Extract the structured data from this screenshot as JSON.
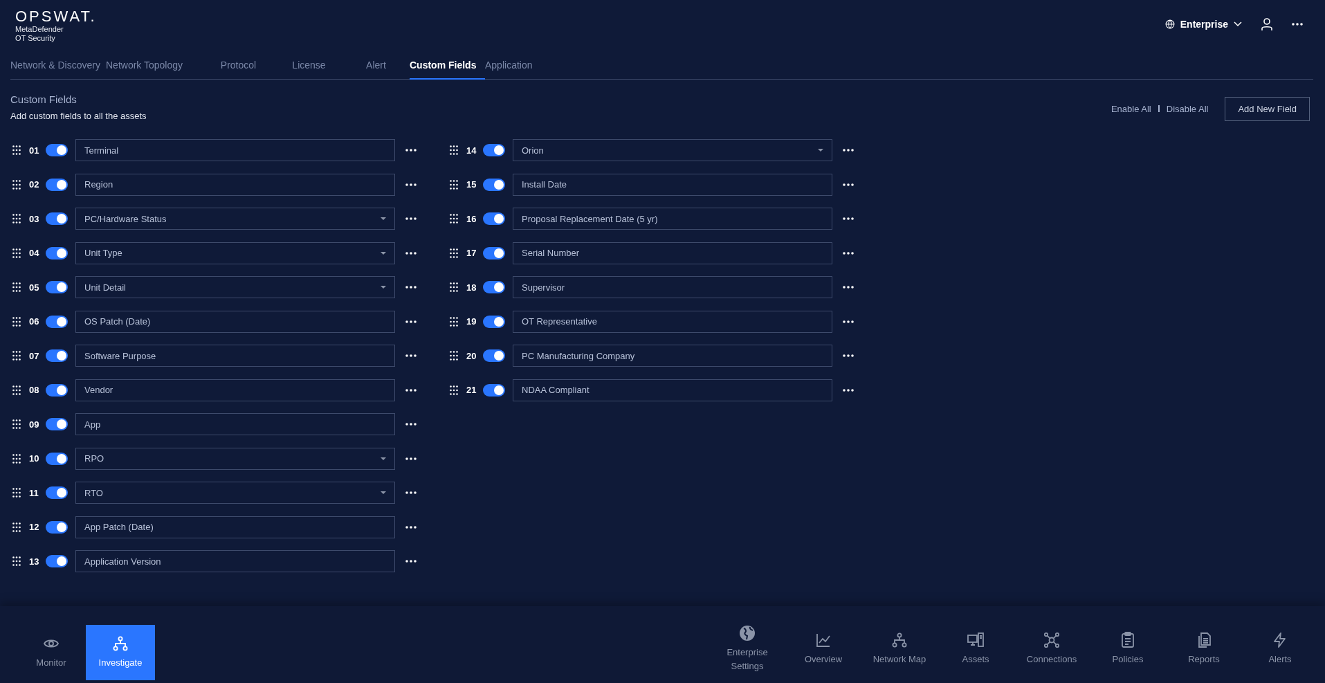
{
  "header": {
    "logo": "OPSWAT.",
    "product": [
      "MetaDefender",
      "OT Security"
    ],
    "workspace": "Enterprise"
  },
  "tabs": [
    {
      "label": "Network & Discovery",
      "selected": false
    },
    {
      "label": "Network Topology",
      "selected": false
    },
    {
      "label": "Protocol",
      "selected": false
    },
    {
      "label": "License",
      "selected": false
    },
    {
      "label": "Alert",
      "selected": false
    },
    {
      "label": "Custom Fields",
      "selected": true
    },
    {
      "label": "Application",
      "selected": false
    }
  ],
  "section": {
    "title": "Custom Fields",
    "subtitle": "Add custom fields to all the assets",
    "enable_all": "Enable All",
    "disable_all": "Disable All",
    "add_button": "Add New Field"
  },
  "field_columns": [
    [
      {
        "number": "01",
        "on": true,
        "kind": "text",
        "value": "Terminal"
      },
      {
        "number": "02",
        "on": true,
        "kind": "text",
        "value": "Region"
      },
      {
        "number": "03",
        "on": true,
        "kind": "dropdown",
        "value": "PC/Hardware Status"
      },
      {
        "number": "04",
        "on": true,
        "kind": "dropdown",
        "value": "Unit Type"
      },
      {
        "number": "05",
        "on": true,
        "kind": "dropdown",
        "value": "Unit Detail"
      },
      {
        "number": "06",
        "on": true,
        "kind": "text",
        "value": "OS Patch (Date)"
      },
      {
        "number": "07",
        "on": true,
        "kind": "text",
        "value": "Software Purpose"
      },
      {
        "number": "08",
        "on": true,
        "kind": "text",
        "value": "Vendor"
      },
      {
        "number": "09",
        "on": true,
        "kind": "text",
        "value": "App"
      },
      {
        "number": "10",
        "on": true,
        "kind": "dropdown",
        "value": "RPO"
      },
      {
        "number": "11",
        "on": true,
        "kind": "dropdown",
        "value": "RTO"
      },
      {
        "number": "12",
        "on": true,
        "kind": "text",
        "value": "App Patch (Date)"
      },
      {
        "number": "13",
        "on": true,
        "kind": "text",
        "value": "Application Version"
      }
    ],
    [
      {
        "number": "14",
        "on": true,
        "kind": "dropdown",
        "value": "Orion"
      },
      {
        "number": "15",
        "on": true,
        "kind": "text",
        "value": "Install Date"
      },
      {
        "number": "16",
        "on": true,
        "kind": "text",
        "value": "Proposal Replacement Date (5 yr)"
      },
      {
        "number": "17",
        "on": true,
        "kind": "text",
        "value": "Serial Number"
      },
      {
        "number": "18",
        "on": true,
        "kind": "text",
        "value": "Supervisor"
      },
      {
        "number": "19",
        "on": true,
        "kind": "text",
        "value": "OT Representative"
      },
      {
        "number": "20",
        "on": true,
        "kind": "text",
        "value": "PC Manufacturing Company"
      },
      {
        "number": "21",
        "on": true,
        "kind": "text",
        "value": "NDAA Compliant"
      }
    ]
  ],
  "bottom_nav_left": [
    {
      "label": "Monitor",
      "kind": "eye",
      "selected": false
    },
    {
      "label": "Investigate",
      "kind": "hierarchy",
      "selected": true
    }
  ],
  "bottom_nav_right": [
    {
      "label": "Enterprise Settings",
      "kind": "globe",
      "selected": false
    },
    {
      "label": "Overview",
      "kind": "chart",
      "selected": false
    },
    {
      "label": "Network Map",
      "kind": "hierarchy",
      "selected": false
    },
    {
      "label": "Assets",
      "kind": "computer",
      "selected": false
    },
    {
      "label": "Connections",
      "kind": "network",
      "selected": false
    },
    {
      "label": "Policies",
      "kind": "clipboard",
      "selected": false
    },
    {
      "label": "Reports",
      "kind": "documents",
      "selected": false
    },
    {
      "label": "Alerts",
      "kind": "bolt",
      "selected": false
    }
  ]
}
